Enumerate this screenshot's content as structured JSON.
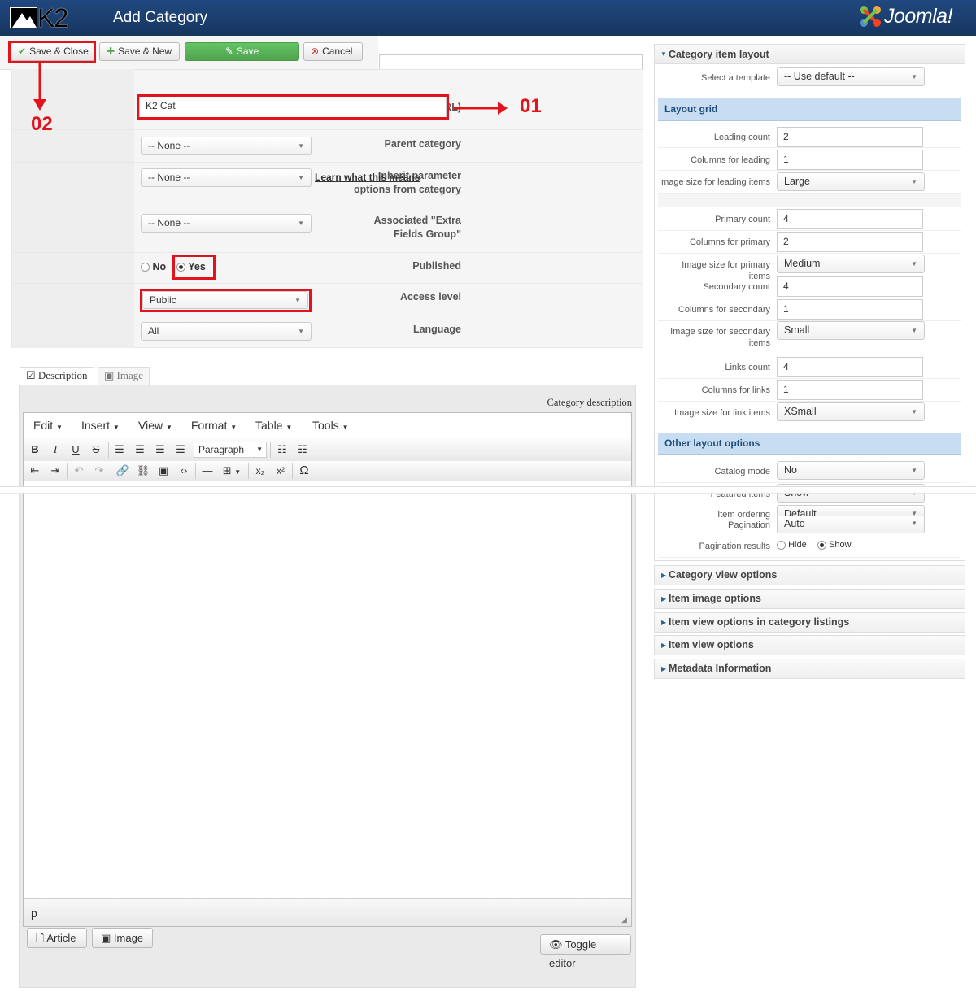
{
  "header": {
    "title": "Add Category",
    "logo_text": "K2",
    "brand": "Joomla!"
  },
  "toolbar": {
    "save_close": "Save & Close",
    "save_new": "Save & New",
    "save": "Save",
    "cancel": "Cancel"
  },
  "annotations": {
    "one": "01",
    "two": "02"
  },
  "form": {
    "title_alias_label": "Title alias (URL)",
    "title_alias_value": "K2 Cat",
    "parent_label": "Parent category",
    "parent_value": "-- None --",
    "inherit_label": "Inherit parameter options from category",
    "inherit_value": "-- None --",
    "inherit_link": "Learn what this means",
    "extra_label": "Associated \"Extra Fields Group\"",
    "extra_value": "-- None --",
    "published_label": "Published",
    "published_no": "No",
    "published_yes": "Yes",
    "access_label": "Access level",
    "access_value": "Public",
    "language_label": "Language",
    "language_value": "All"
  },
  "tabs": {
    "description": "Description",
    "image": "Image"
  },
  "editor": {
    "caption": "Category description",
    "menus": [
      "Edit",
      "Insert",
      "View",
      "Format",
      "Table",
      "Tools"
    ],
    "paragraph": "Paragraph",
    "path": "p",
    "btn_article": "Article",
    "btn_image": "Image",
    "btn_toggle": "Toggle editor"
  },
  "right": {
    "layout_head": "Category item layout",
    "template_label": "Select a template",
    "template_value": "-- Use default --",
    "grid_head": "Layout grid",
    "leading_count_label": "Leading count",
    "leading_count": "2",
    "leading_cols_label": "Columns for leading",
    "leading_cols": "1",
    "leading_img_label": "Image size for leading items",
    "leading_img": "Large",
    "primary_count_label": "Primary count",
    "primary_count": "4",
    "primary_cols_label": "Columns for primary",
    "primary_cols": "2",
    "primary_img_label": "Image size for primary items",
    "primary_img": "Medium",
    "secondary_count_label": "Secondary count",
    "secondary_count": "4",
    "secondary_cols_label": "Columns for secondary",
    "secondary_cols": "1",
    "secondary_img_label_1": "Image size for secondary",
    "secondary_img_label_2": "items",
    "secondary_img": "Small",
    "links_count_label": "Links count",
    "links_count": "4",
    "links_cols_label": "Columns for links",
    "links_cols": "1",
    "links_img_label": "Image size for link items",
    "links_img": "XSmall",
    "other_head": "Other layout options",
    "catalog_label": "Catalog mode",
    "catalog_value": "No",
    "featured_label": "Featured items",
    "featured_value": "Show",
    "ordering_label": "Item ordering",
    "ordering_value": "Default",
    "pagination_label": "Pagination",
    "pagination_value": "Auto",
    "pagination_results_label": "Pagination results",
    "pr_hide": "Hide",
    "pr_show": "Show",
    "acc1": "Category view options",
    "acc2": "Item image options",
    "acc3": "Item view options in category listings",
    "acc4": "Item view options",
    "acc5": "Metadata Information"
  }
}
